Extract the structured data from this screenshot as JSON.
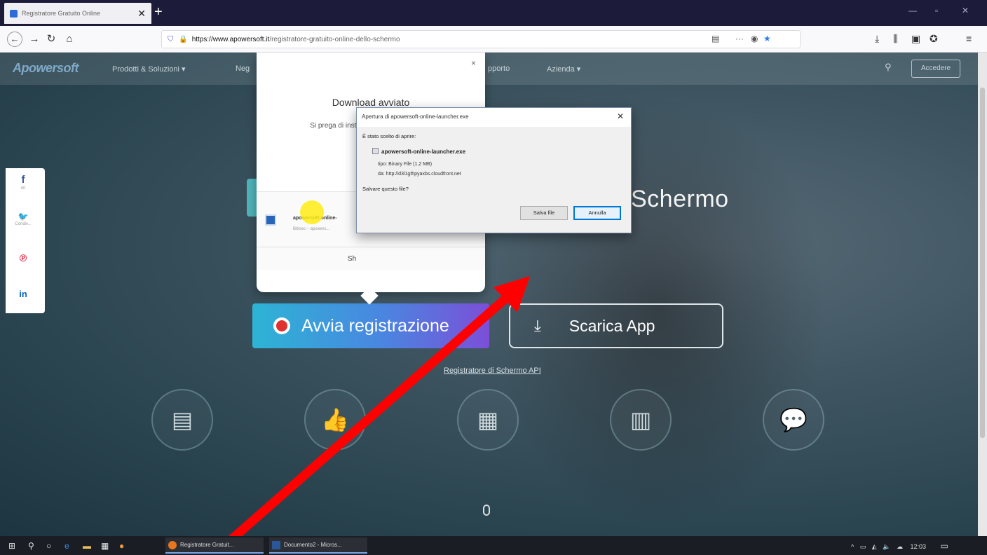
{
  "browser": {
    "tab_title": "Registratore Gratuito Online",
    "tab_close": "✕",
    "new_tab": "+",
    "url_host": "https://www.apowersoft.it",
    "url_path": "/registratore-gratuito-online-dello-schermo",
    "menu_dots": "···",
    "win_controls": [
      "—",
      "▫",
      "✕"
    ]
  },
  "site": {
    "logo": "Apowersoft",
    "nav": [
      "Prodotti & Soluzioni ▾",
      "Neg",
      "pporto",
      "Azienda ▾"
    ],
    "access": "Accedere",
    "heading": "Schermo",
    "record_button": "Avvia registrazione",
    "app_button": "Scarica App",
    "api_link": "Registratore di Schermo API",
    "social": [
      {
        "icon": "f",
        "count": "40",
        "color": "#3b5998"
      },
      {
        "icon": "t",
        "count": "Condiv...",
        "color": "#1da1f2"
      },
      {
        "icon": "p",
        "count": "",
        "color": "#e60023"
      },
      {
        "icon": "in",
        "count": "",
        "color": "#0a66c2"
      }
    ]
  },
  "download_popup": {
    "close": "×",
    "title": "Download avviato",
    "subtitle": "Si prega di installarlo dopo il download!",
    "file_name": "apowersoft-online-",
    "file_status": "Bit/sec – apowers...",
    "button_partial": "Sh"
  },
  "save_dialog": {
    "title": "Apertura di apowersoft-online-launcher.exe",
    "close": "✕",
    "chosen_label": "È stato scelto di aprire:",
    "file_name": "apowersoft-online-launcher.exe",
    "type_line": "tipo: Binary File (1,2 MB)",
    "from_line": "da: http://d3l1gthpyaxbs.cloudfront.net",
    "question": "Salvare questo file?",
    "save_button": "Salva file",
    "cancel_button": "Annulla"
  },
  "taskbar": {
    "apps": [
      {
        "label": "Registratore Gratuit...",
        "color": "#e8761e"
      },
      {
        "label": "Documento2 - Micros...",
        "color": "#2b5797"
      }
    ],
    "clock": "12:03"
  },
  "colors": {
    "annotation_arrow": "#ff0000",
    "record_gradient_start": "#2db4d5",
    "record_gradient_end": "#7b4fd8",
    "tab_bar": "#1c1b3a"
  }
}
